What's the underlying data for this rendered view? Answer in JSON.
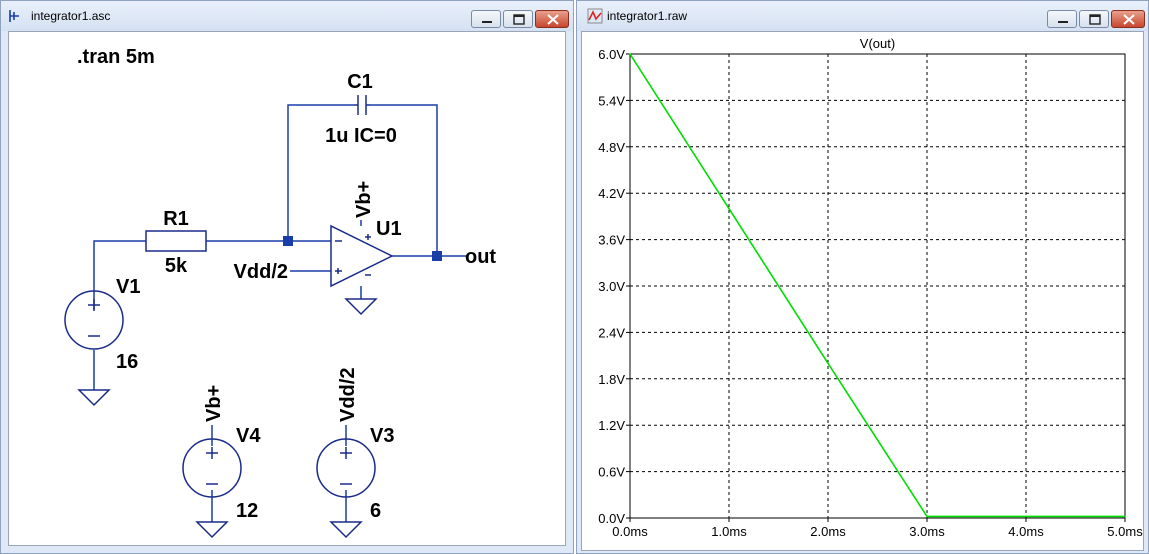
{
  "schematic_window": {
    "title": "integrator1.asc",
    "directive": ".tran 5m",
    "components": {
      "c1": {
        "name": "C1",
        "value": "1u IC=0"
      },
      "r1": {
        "name": "R1",
        "value": "5k"
      },
      "u1": {
        "name": "U1"
      },
      "v1": {
        "name": "V1",
        "value": "16"
      },
      "v4": {
        "name": "V4",
        "value": "12"
      },
      "v3": {
        "name": "V3",
        "value": "6"
      }
    },
    "net_labels": {
      "vb_opamp": "Vb+",
      "vdd_opamp": "Vdd/2",
      "out": "out",
      "vb_source": "Vb+",
      "vdd_source": "Vdd/2"
    },
    "wire_color": "#1a3ea8",
    "symbol_color": "#1a2a8a"
  },
  "plot_window": {
    "title": "integrator1.raw",
    "chart_data": {
      "type": "line",
      "title": "V(out)",
      "xlabel": "",
      "ylabel": "",
      "x_unit": "ms",
      "y_unit": "V",
      "xlim": [
        0,
        5
      ],
      "ylim": [
        0,
        6
      ],
      "grid": true,
      "x_ticks": [
        "0.0ms",
        "1.0ms",
        "2.0ms",
        "3.0ms",
        "4.0ms",
        "5.0ms"
      ],
      "y_ticks": [
        "0.0V",
        "0.6V",
        "1.2V",
        "1.8V",
        "2.4V",
        "3.0V",
        "3.6V",
        "4.2V",
        "4.8V",
        "5.4V",
        "6.0V"
      ],
      "series": [
        {
          "name": "V(out)",
          "color": "#00dd00",
          "x": [
            0,
            1,
            2,
            3,
            3.5,
            4,
            5
          ],
          "y": [
            6.0,
            4.0,
            2.0,
            0.02,
            0.02,
            0.02,
            0.02
          ]
        }
      ]
    }
  }
}
